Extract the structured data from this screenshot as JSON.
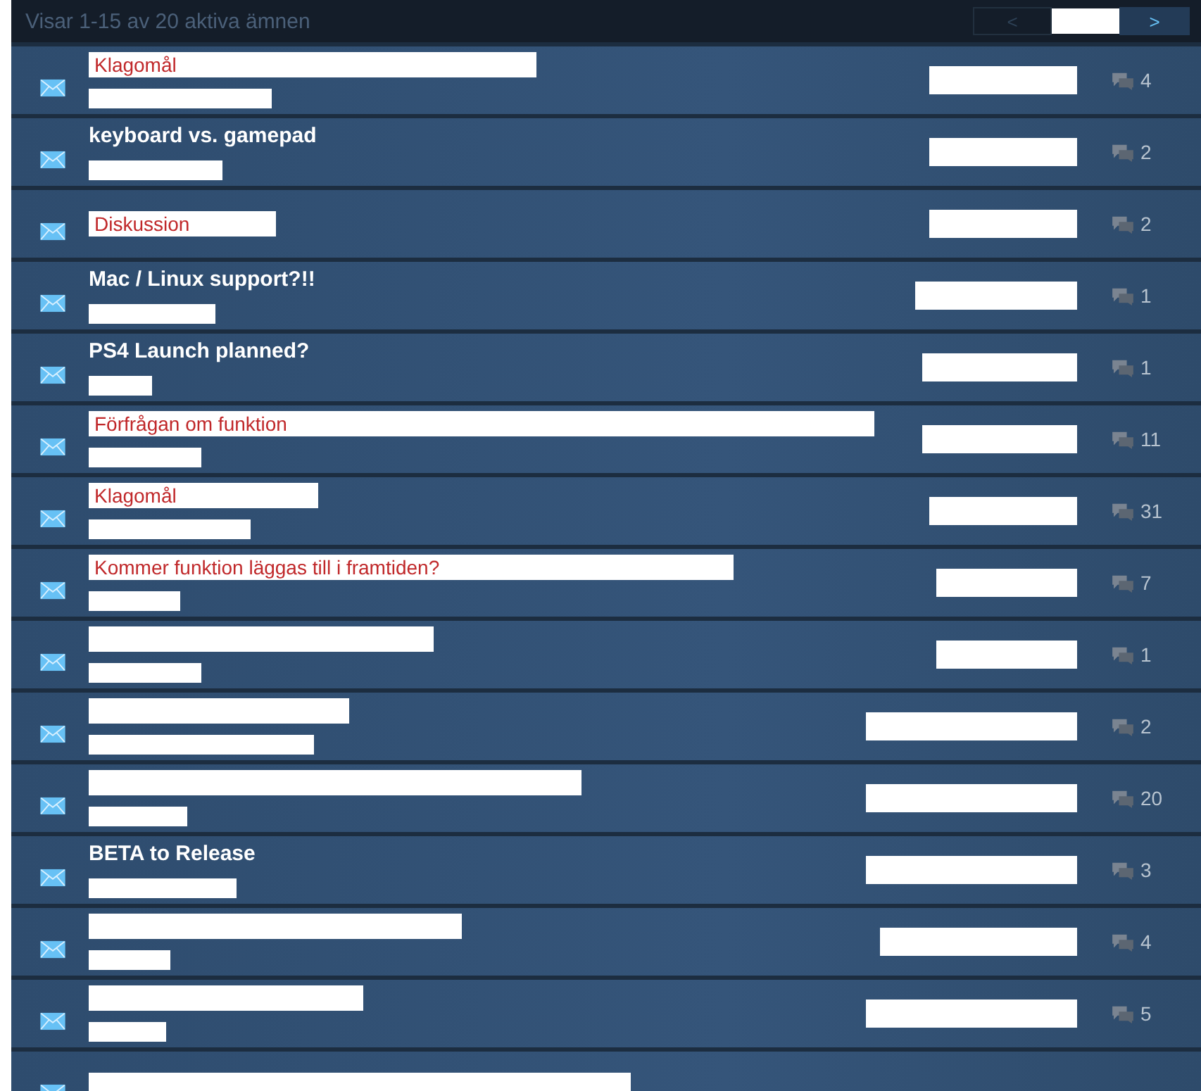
{
  "header": {
    "summary": "Visar 1-15 av 20 aktiva ämnen",
    "pager": {
      "prev": "<",
      "next": ">"
    }
  },
  "topics": [
    {
      "kind": "annotated",
      "title": "Klagomål",
      "replies": "4"
    },
    {
      "kind": "plain",
      "title": "keyboard vs. gamepad",
      "replies": "2"
    },
    {
      "kind": "annotated",
      "title": "Diskussion",
      "replies": "2"
    },
    {
      "kind": "plain",
      "title": "Mac / Linux support?!!",
      "replies": "1"
    },
    {
      "kind": "plain",
      "title": "PS4 Launch planned?",
      "replies": "1"
    },
    {
      "kind": "annotated",
      "title": "Förfrågan om funktion",
      "replies": "11"
    },
    {
      "kind": "annotated",
      "title": "Klagomål",
      "replies": "31"
    },
    {
      "kind": "annotated",
      "title": "Kommer funktion läggas till i framtiden?",
      "replies": "7"
    },
    {
      "kind": "redacted",
      "replies": "1"
    },
    {
      "kind": "redacted",
      "replies": "2"
    },
    {
      "kind": "redacted",
      "replies": "20"
    },
    {
      "kind": "plain",
      "title": "BETA to Release",
      "replies": "3"
    },
    {
      "kind": "redacted",
      "replies": "4"
    },
    {
      "kind": "redacted",
      "replies": "5"
    },
    {
      "kind": "redacted"
    }
  ]
}
